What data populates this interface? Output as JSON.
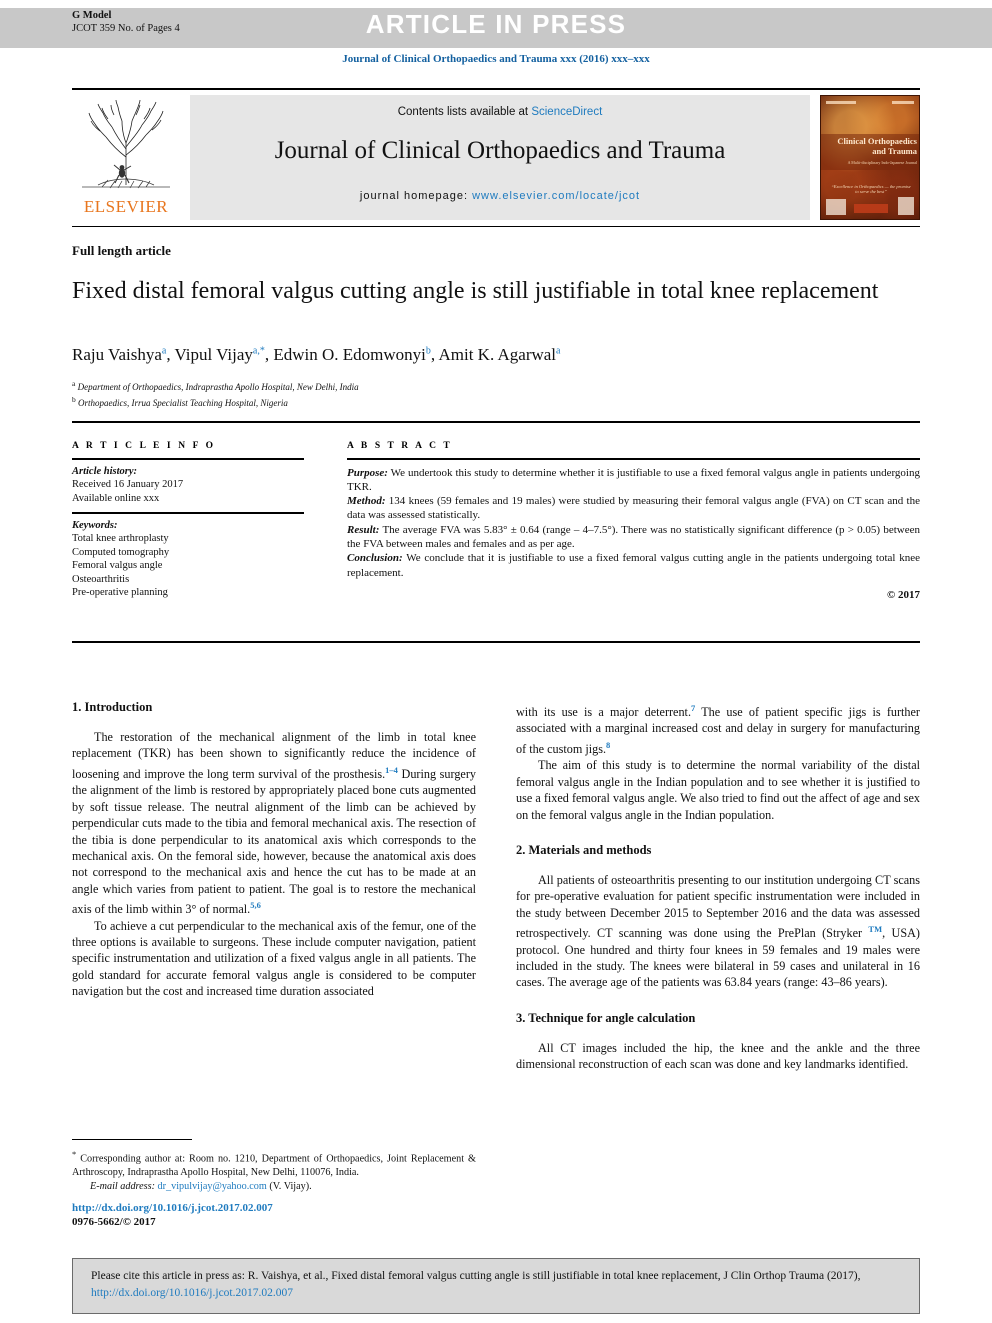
{
  "header": {
    "gmodel_line1": "G Model",
    "gmodel_line2": "JCOT 359 No. of Pages 4",
    "press_banner": "ARTICLE IN PRESS",
    "journal_running_head": "Journal of Clinical Orthopaedics and Trauma xxx (2016) xxx–xxx"
  },
  "masthead": {
    "contents_prefix": "Contents lists available at ",
    "contents_link": "ScienceDirect",
    "journal_name": "Journal of Clinical Orthopaedics and Trauma",
    "homepage_label": "journal homepage: ",
    "homepage_url": "www.elsevier.com/locate/jcot",
    "publisher": "ELSEVIER",
    "cover": {
      "title": "Clinical Orthopaedics and Trauma",
      "subtitle": "A Multi-disciplinary Indo-Japanese Journal",
      "quote": "“Excellence in Orthopaedics — the promise to serve the best”"
    }
  },
  "article": {
    "type": "Full length article",
    "title": "Fixed distal femoral valgus cutting angle is still justifiable in total knee replacement",
    "authors_html": "Raju Vaishya<sup>a</sup>, Vipul Vijay<sup>a,*</sup>, Edwin O. Edomwonyi<sup>b</sup>, Amit K. Agarwal<sup>a</sup>",
    "affiliation_a": "Department of Orthopaedics, Indraprastha Apollo Hospital, New Delhi, India",
    "affiliation_b": "Orthopaedics, Irrua Specialist Teaching Hospital, Nigeria"
  },
  "info": {
    "heading": "A R T I C L E   I N F O",
    "history_label": "Article history:",
    "received": "Received 16 January 2017",
    "available": "Available online xxx",
    "keywords_label": "Keywords:",
    "keywords": [
      "Total knee arthroplasty",
      "Computed tomography",
      "Femoral valgus angle",
      "Osteoarthritis",
      "Pre-operative planning"
    ]
  },
  "abstract": {
    "heading": "A B S T R A C T",
    "purpose_label": "Purpose:",
    "purpose_text": " We undertook this study to determine whether it is justifiable to use a fixed femoral valgus angle in patients undergoing TKR.",
    "method_label": "Method:",
    "method_text": " 134 knees (59 females and 19 males) were studied by measuring their femoral valgus angle (FVA) on CT scan and the data was assessed statistically.",
    "result_label": "Result:",
    "result_text": " The average FVA was 5.83° ± 0.64 (range – 4–7.5°). There was no statistically significant difference (p > 0.05) between the FVA between males and females and as per age.",
    "conclusion_label": "Conclusion:",
    "conclusion_text": " We conclude that it is justifiable to use a fixed femoral valgus cutting angle in the patients undergoing total knee replacement.",
    "copyright": "© 2017"
  },
  "body": {
    "left": {
      "h_introduction": "1. Introduction",
      "p1_a": "The restoration of the mechanical alignment of the limb in total knee replacement (TKR) has been shown to significantly reduce the incidence of loosening and improve the long term survival of the prosthesis.",
      "p1_sup1": "1–4",
      "p1_b": " During surgery the alignment of the limb is restored by appropriately placed bone cuts augmented by soft tissue release. The neutral alignment of the limb can be achieved by perpendicular cuts made to the tibia and femoral mechanical axis. The resection of the tibia is done perpendicular to its anatomical axis which corresponds to the mechanical axis. On the femoral side, however, because the anatomical axis does not correspond to the mechanical axis and hence the cut has to be made at an angle which varies from patient to patient. The goal is to restore the mechanical axis of the limb within 3° of normal.",
      "p1_sup2": "5,6",
      "p2": "To achieve a cut perpendicular to the mechanical axis of the femur, one of the three options is available to surgeons. These include computer navigation, patient specific instrumentation and utilization of a fixed valgus angle in all patients. The gold standard for accurate femoral valgus angle is considered to be computer navigation but the cost and increased time duration associated"
    },
    "right": {
      "p3_a": "with its use is a major deterrent.",
      "p3_sup1": "7",
      "p3_b": " The use of patient specific jigs is further associated with a marginal increased cost and delay in surgery for manufacturing of the custom jigs.",
      "p3_sup2": "8",
      "p4": "The aim of this study is to determine the normal variability of the distal femoral valgus angle in the Indian population and to see whether it is justified to use a fixed femoral valgus angle. We also tried to find out the affect of age and sex on the femoral valgus angle in the Indian population.",
      "h_materials": "2. Materials and methods",
      "p5_a": "All patients of osteoarthritis presenting to our institution undergoing CT scans for pre-operative evaluation for patient specific instrumentation were included in the study between December 2015 to September 2016 and the data was assessed retrospectively. CT scanning was done using the PrePlan (Stryker ",
      "p5_sup": "TM",
      "p5_b": ", USA) protocol. One hundred and thirty four knees in 59 females and 19 males were included in the study. The knees were bilateral in 59 cases and unilateral in 16 cases. The average age of the patients was 63.84 years (range: 43–86 years).",
      "h_technique": "3. Technique for angle calculation",
      "p6": "All CT images included the hip, the knee and the ankle and the three dimensional reconstruction of each scan was done and key landmarks identified."
    }
  },
  "footnotes": {
    "corresponding_marker": "*",
    "corresponding_text": " Corresponding author at: Room no. 1210, Department of Orthopaedics, Joint Replacement & Arthroscopy, Indraprastha Apollo Hospital, New Delhi, 110076, India.",
    "email_label": "E-mail address:",
    "email": "dr_vipulvijay@yahoo.com",
    "email_suffix": " (V. Vijay).",
    "doi": "http://dx.doi.org/10.1016/j.jcot.2017.02.007",
    "issn": "0976-5662/© 2017"
  },
  "citation": {
    "text_before": "Please cite this article in press as: R. Vaishya, et al., Fixed distal femoral valgus cutting angle is still justifiable in total knee replacement, J Clin Orthop Trauma (2017), ",
    "link": "http://dx.doi.org/10.1016/j.jcot.2017.02.007"
  },
  "colors": {
    "link": "#1f7bbf",
    "banner_bg": "#c8c8c8",
    "masthead_bg": "#e6e6e6",
    "citation_bg": "#d9d9d9",
    "elsevier_orange": "#e8761e"
  }
}
